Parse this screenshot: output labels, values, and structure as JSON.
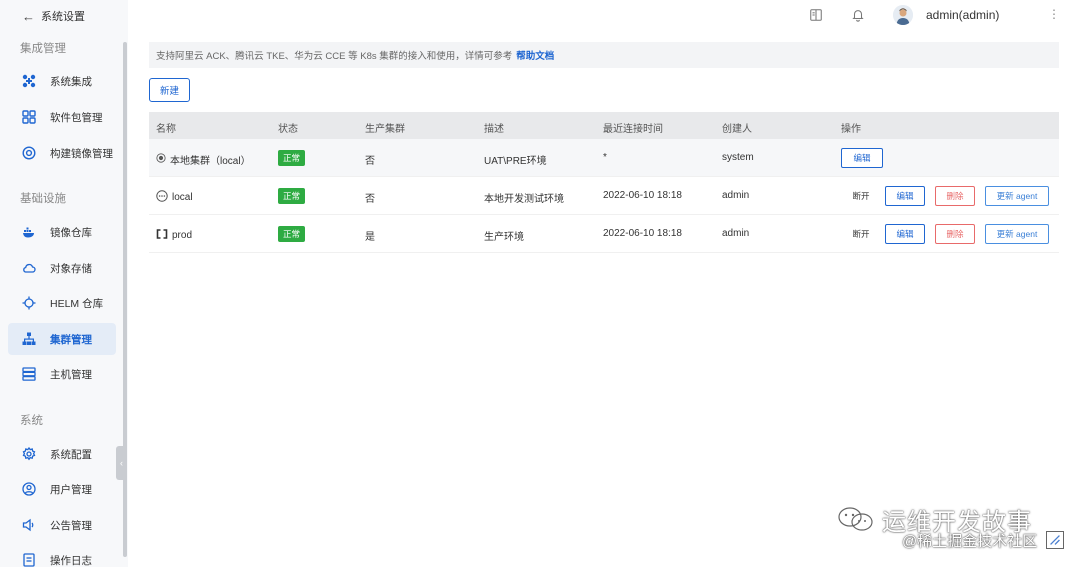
{
  "sidebar": {
    "back_label": "系统设置",
    "sections": [
      {
        "title": "集成管理"
      },
      {
        "title": "基础设施"
      },
      {
        "title": "系统"
      }
    ],
    "items": [
      {
        "label": "系统集成",
        "icon": "integration-icon"
      },
      {
        "label": "软件包管理",
        "icon": "package-icon"
      },
      {
        "label": "构建镜像管理",
        "icon": "build-image-icon"
      },
      {
        "label": "镜像仓库",
        "icon": "docker-icon"
      },
      {
        "label": "对象存储",
        "icon": "cloud-icon"
      },
      {
        "label": "HELM 仓库",
        "icon": "helm-icon"
      },
      {
        "label": "集群管理",
        "icon": "cluster-icon",
        "active": true
      },
      {
        "label": "主机管理",
        "icon": "host-icon"
      },
      {
        "label": "系统配置",
        "icon": "gear-icon"
      },
      {
        "label": "用户管理",
        "icon": "user-icon"
      },
      {
        "label": "公告管理",
        "icon": "announcement-icon"
      },
      {
        "label": "操作日志",
        "icon": "log-icon"
      }
    ]
  },
  "header": {
    "user": "admin(admin)"
  },
  "notice": {
    "text": "支持阿里云 ACK、腾讯云 TKE、华为云 CCE 等 K8s 集群的接入和使用，详情可参考",
    "link": "帮助文档"
  },
  "toolbar": {
    "new_label": "新建"
  },
  "table": {
    "columns": [
      "名称",
      "状态",
      "生产集群",
      "描述",
      "最近连接时间",
      "创建人",
      "操作"
    ],
    "rows": [
      {
        "name": "本地集群（local）",
        "icon": "local-cluster-icon",
        "status": "正常",
        "production": "否",
        "description": "UAT\\PRE环境",
        "last_connected": "*",
        "creator": "system",
        "actions": [
          "编辑"
        ]
      },
      {
        "name": "local",
        "icon": "dots-cluster-icon",
        "status": "正常",
        "production": "否",
        "description": "本地开发测试环境",
        "last_connected": "2022-06-10 18:18",
        "creator": "admin",
        "actions": [
          "断开",
          "编辑",
          "删除",
          "更新 agent"
        ]
      },
      {
        "name": "prod",
        "icon": "bracket-cluster-icon",
        "status": "正常",
        "production": "是",
        "description": "生产环境",
        "last_connected": "2022-06-10 18:18",
        "creator": "admin",
        "actions": [
          "断开",
          "编辑",
          "删除",
          "更新 agent"
        ]
      }
    ]
  },
  "watermark": {
    "line1": "运维开发故事",
    "line2": "@稀土掘金技术社区"
  },
  "colors": {
    "accent": "#1f66d1",
    "status_ok": "#2eab42",
    "danger": "#e86a6a"
  }
}
